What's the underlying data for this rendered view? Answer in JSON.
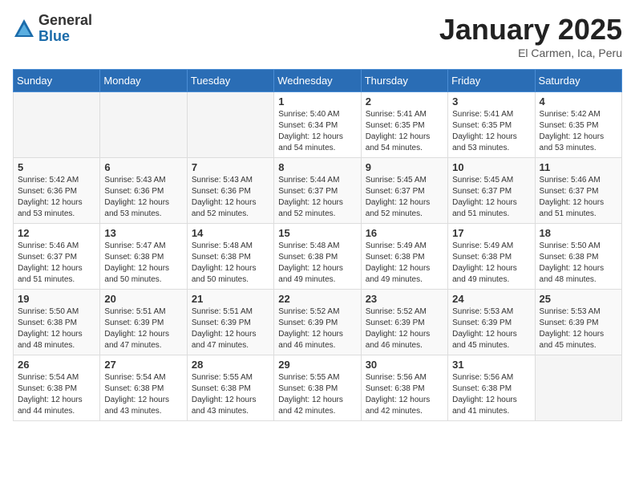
{
  "header": {
    "logo_general": "General",
    "logo_blue": "Blue",
    "month_title": "January 2025",
    "location": "El Carmen, Ica, Peru"
  },
  "calendar": {
    "days_of_week": [
      "Sunday",
      "Monday",
      "Tuesday",
      "Wednesday",
      "Thursday",
      "Friday",
      "Saturday"
    ],
    "weeks": [
      [
        {
          "day": "",
          "info": ""
        },
        {
          "day": "",
          "info": ""
        },
        {
          "day": "",
          "info": ""
        },
        {
          "day": "1",
          "info": "Sunrise: 5:40 AM\nSunset: 6:34 PM\nDaylight: 12 hours\nand 54 minutes."
        },
        {
          "day": "2",
          "info": "Sunrise: 5:41 AM\nSunset: 6:35 PM\nDaylight: 12 hours\nand 54 minutes."
        },
        {
          "day": "3",
          "info": "Sunrise: 5:41 AM\nSunset: 6:35 PM\nDaylight: 12 hours\nand 53 minutes."
        },
        {
          "day": "4",
          "info": "Sunrise: 5:42 AM\nSunset: 6:35 PM\nDaylight: 12 hours\nand 53 minutes."
        }
      ],
      [
        {
          "day": "5",
          "info": "Sunrise: 5:42 AM\nSunset: 6:36 PM\nDaylight: 12 hours\nand 53 minutes."
        },
        {
          "day": "6",
          "info": "Sunrise: 5:43 AM\nSunset: 6:36 PM\nDaylight: 12 hours\nand 53 minutes."
        },
        {
          "day": "7",
          "info": "Sunrise: 5:43 AM\nSunset: 6:36 PM\nDaylight: 12 hours\nand 52 minutes."
        },
        {
          "day": "8",
          "info": "Sunrise: 5:44 AM\nSunset: 6:37 PM\nDaylight: 12 hours\nand 52 minutes."
        },
        {
          "day": "9",
          "info": "Sunrise: 5:45 AM\nSunset: 6:37 PM\nDaylight: 12 hours\nand 52 minutes."
        },
        {
          "day": "10",
          "info": "Sunrise: 5:45 AM\nSunset: 6:37 PM\nDaylight: 12 hours\nand 51 minutes."
        },
        {
          "day": "11",
          "info": "Sunrise: 5:46 AM\nSunset: 6:37 PM\nDaylight: 12 hours\nand 51 minutes."
        }
      ],
      [
        {
          "day": "12",
          "info": "Sunrise: 5:46 AM\nSunset: 6:37 PM\nDaylight: 12 hours\nand 51 minutes."
        },
        {
          "day": "13",
          "info": "Sunrise: 5:47 AM\nSunset: 6:38 PM\nDaylight: 12 hours\nand 50 minutes."
        },
        {
          "day": "14",
          "info": "Sunrise: 5:48 AM\nSunset: 6:38 PM\nDaylight: 12 hours\nand 50 minutes."
        },
        {
          "day": "15",
          "info": "Sunrise: 5:48 AM\nSunset: 6:38 PM\nDaylight: 12 hours\nand 49 minutes."
        },
        {
          "day": "16",
          "info": "Sunrise: 5:49 AM\nSunset: 6:38 PM\nDaylight: 12 hours\nand 49 minutes."
        },
        {
          "day": "17",
          "info": "Sunrise: 5:49 AM\nSunset: 6:38 PM\nDaylight: 12 hours\nand 49 minutes."
        },
        {
          "day": "18",
          "info": "Sunrise: 5:50 AM\nSunset: 6:38 PM\nDaylight: 12 hours\nand 48 minutes."
        }
      ],
      [
        {
          "day": "19",
          "info": "Sunrise: 5:50 AM\nSunset: 6:38 PM\nDaylight: 12 hours\nand 48 minutes."
        },
        {
          "day": "20",
          "info": "Sunrise: 5:51 AM\nSunset: 6:39 PM\nDaylight: 12 hours\nand 47 minutes."
        },
        {
          "day": "21",
          "info": "Sunrise: 5:51 AM\nSunset: 6:39 PM\nDaylight: 12 hours\nand 47 minutes."
        },
        {
          "day": "22",
          "info": "Sunrise: 5:52 AM\nSunset: 6:39 PM\nDaylight: 12 hours\nand 46 minutes."
        },
        {
          "day": "23",
          "info": "Sunrise: 5:52 AM\nSunset: 6:39 PM\nDaylight: 12 hours\nand 46 minutes."
        },
        {
          "day": "24",
          "info": "Sunrise: 5:53 AM\nSunset: 6:39 PM\nDaylight: 12 hours\nand 45 minutes."
        },
        {
          "day": "25",
          "info": "Sunrise: 5:53 AM\nSunset: 6:39 PM\nDaylight: 12 hours\nand 45 minutes."
        }
      ],
      [
        {
          "day": "26",
          "info": "Sunrise: 5:54 AM\nSunset: 6:38 PM\nDaylight: 12 hours\nand 44 minutes."
        },
        {
          "day": "27",
          "info": "Sunrise: 5:54 AM\nSunset: 6:38 PM\nDaylight: 12 hours\nand 43 minutes."
        },
        {
          "day": "28",
          "info": "Sunrise: 5:55 AM\nSunset: 6:38 PM\nDaylight: 12 hours\nand 43 minutes."
        },
        {
          "day": "29",
          "info": "Sunrise: 5:55 AM\nSunset: 6:38 PM\nDaylight: 12 hours\nand 42 minutes."
        },
        {
          "day": "30",
          "info": "Sunrise: 5:56 AM\nSunset: 6:38 PM\nDaylight: 12 hours\nand 42 minutes."
        },
        {
          "day": "31",
          "info": "Sunrise: 5:56 AM\nSunset: 6:38 PM\nDaylight: 12 hours\nand 41 minutes."
        },
        {
          "day": "",
          "info": ""
        }
      ]
    ]
  }
}
